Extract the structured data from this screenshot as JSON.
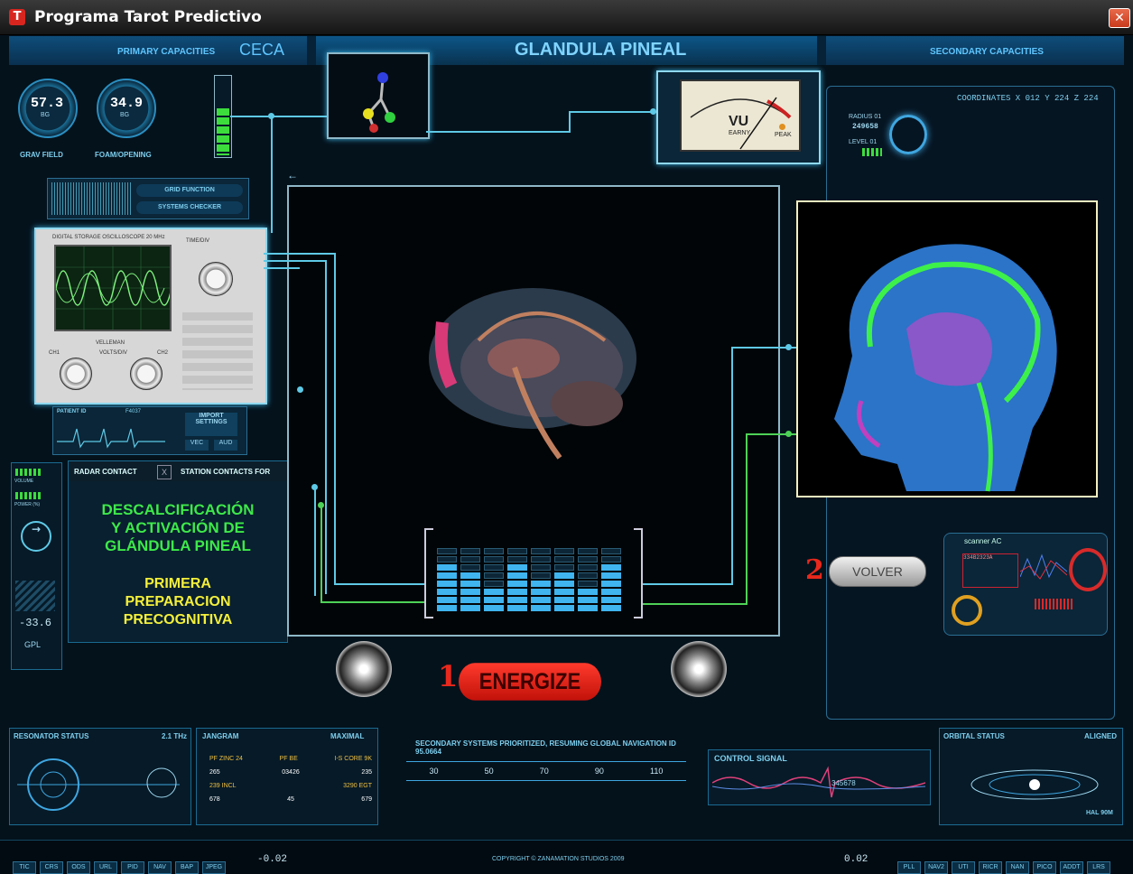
{
  "window": {
    "title": "Programa Tarot Predictivo",
    "close": "✕",
    "app_icon": "T"
  },
  "header": {
    "primary": "PRIMARY CAPACITIES",
    "ceca": "CECA",
    "title": "GLANDULA PINEAL",
    "secondary": "SECONDARY CAPACITIES"
  },
  "gauges": [
    {
      "value": "57.3",
      "unit": "BG",
      "label": "GRAV FIELD"
    },
    {
      "value": "34.9",
      "unit": "BG",
      "label": "FOAM/OPENING"
    }
  ],
  "vu_meter": {
    "label": "VU",
    "brand": "EARNY",
    "peak": "PEAK",
    "scale": [
      "20",
      "10",
      "7",
      "5",
      "3",
      "0",
      "1",
      "2",
      "3"
    ]
  },
  "coordinates": "COORDINATES  X 012  Y 224  Z 224",
  "radius": {
    "label1": "RADIUS 01",
    "value": "249658",
    "label2": "LEVEL 01"
  },
  "grid": {
    "grid_function": "GRID FUNCTION",
    "systems_checker": "SYSTEMS CHECKER"
  },
  "oscilloscope": {
    "title": "DIGITAL STORAGE OSCILLOSCOPE 20 MHz",
    "timediv": "TIME/DIV",
    "voltsdiv": "VOLTS/DIV",
    "ch1": "CH1",
    "ch2": "CH2",
    "brand": "VELLEMAN"
  },
  "patient": {
    "label": "PATIENT ID",
    "id": "F4037",
    "import_settings": "IMPORT SETTINGS",
    "val1": "VEC",
    "val2": "AUD"
  },
  "radar": {
    "contact": "RADAR CONTACT",
    "close": "X",
    "station": "STATION CONTACTS FOR"
  },
  "left_meters": {
    "volume": "VOLUME",
    "power": "POWER (%)",
    "reading": "-33.6",
    "gpl": "GPL"
  },
  "main_text": {
    "green": [
      "DESCALCIFICACIÓN",
      "Y ACTIVACIÓN DE",
      "GLÁNDULA PINEAL"
    ],
    "yellow": [
      "PRIMERA",
      "PREPARACION",
      "PRECOGNITIVA"
    ]
  },
  "actions": {
    "energize_number": "1",
    "energize": "ENERGIZE",
    "volver_number": "2",
    "volver": "VOLVER"
  },
  "scanner": {
    "label": "scanner AC",
    "code": "334B2323A"
  },
  "equalizer": {
    "levels": [
      6,
      5,
      3,
      6,
      4,
      5,
      3,
      6
    ],
    "max": 8
  },
  "bottom": {
    "resonator": {
      "title": "RESONATOR STATUS",
      "value": "2.1 THz"
    },
    "diagram": {
      "title": "JANGRAM",
      "mode": "MAXIMAL",
      "rows": [
        [
          "PF ZINC 24",
          "PF BE",
          "I-S CORE 9K"
        ],
        [
          "265",
          "03426",
          "235"
        ],
        [
          "239 INCL",
          "",
          "3290 EGT"
        ],
        [
          "678",
          "45",
          "679"
        ]
      ]
    },
    "nav": {
      "text": "SECONDARY SYSTEMS PRIORITIZED, RESUMING GLOBAL NAVIGATION ID 95.0664",
      "ticks": [
        "30",
        "50",
        "70",
        "90",
        "110"
      ]
    },
    "control": {
      "title": "CONTROL SIGNAL",
      "value": "345678"
    },
    "orbital": {
      "title": "ORBITAL STATUS",
      "state": "ALIGNED",
      "mode": "HAL 90M"
    }
  },
  "footer": {
    "left_tabs": [
      "TIC",
      "CRS",
      "ODS",
      "URL",
      "PID",
      "NAV",
      "BAP",
      "JPEG"
    ],
    "left_reading": "-0.02",
    "copyright": "COPYRIGHT © ZANAMATION STUDIOS 2009",
    "right_reading": "0.02",
    "right_tabs": [
      "PLL",
      "NAV2",
      "UTI",
      "RICR",
      "NAN",
      "PICO",
      "ADDT",
      "LRS"
    ]
  }
}
